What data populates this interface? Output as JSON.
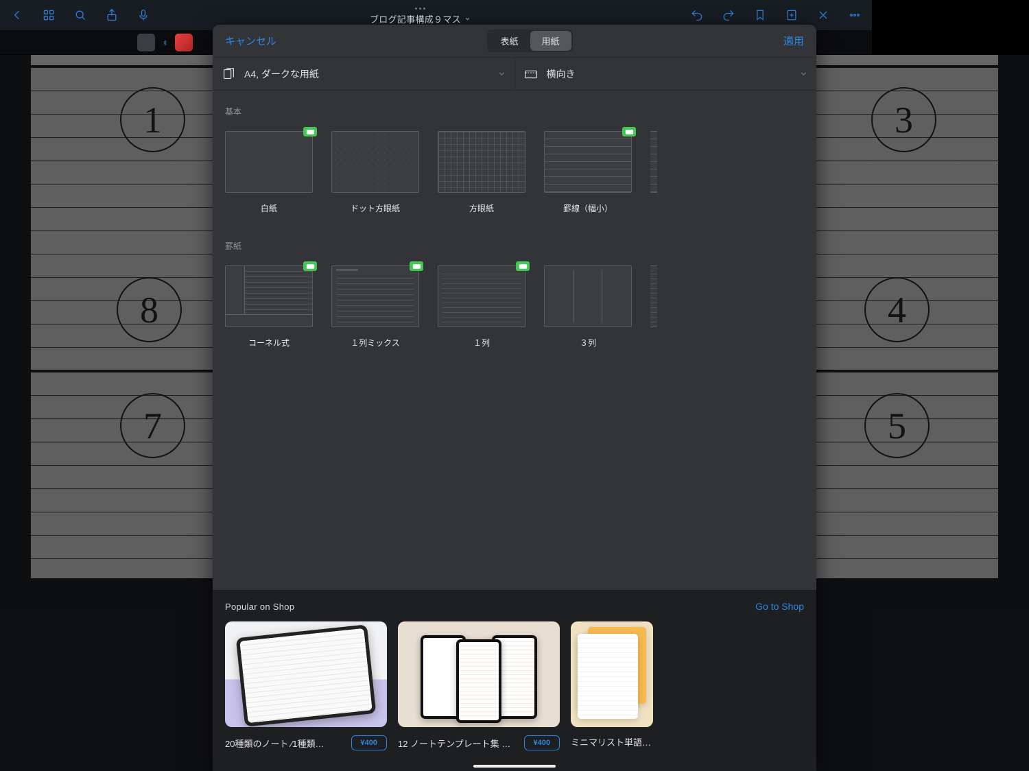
{
  "toolbar": {
    "doc_title": "ブログ記事構成９マス"
  },
  "modal": {
    "cancel": "キャンセル",
    "apply": "適用",
    "tabs": {
      "cover": "表紙",
      "paper": "用紙"
    },
    "paper_format": "A4, ダークな用紙",
    "orientation": "横向き",
    "section_basic": "基本",
    "section_ruled": "罫紙",
    "templates_basic": [
      "白紙",
      "ドット方眼紙",
      "方眼紙",
      "罫線（幅小）"
    ],
    "templates_ruled": [
      "コーネル式",
      "１列ミックス",
      "１列",
      "３列"
    ],
    "shop": {
      "popular": "Popular on Shop",
      "go": "Go to Shop",
      "items": [
        "20種類のノート ⁄1種類…",
        "12 ノートテンプレート集 …",
        "ミニマリスト単語帳 …"
      ],
      "price": "¥400"
    }
  }
}
